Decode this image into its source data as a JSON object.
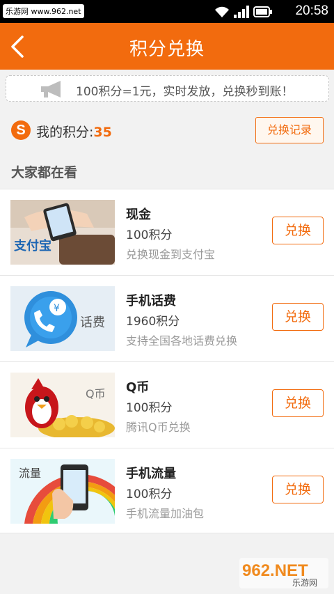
{
  "status_bar": {
    "watermark": "乐游网 www.962.net",
    "time": "20:58",
    "icons": [
      "wifi-icon",
      "signal-icon",
      "battery-icon"
    ]
  },
  "header": {
    "back_icon": "chevron-left-icon",
    "title": "积分兑换"
  },
  "notice": {
    "icon": "megaphone-icon",
    "text": "100积分=1元，实时发放，兑换秒到账！"
  },
  "points": {
    "label": "我的积分:",
    "value": "35",
    "record_button": "兑换记录"
  },
  "section_title": "大家都在看",
  "items": [
    {
      "name": "现金",
      "cost": "100积分",
      "desc": "兑换现金到支付宝",
      "button": "兑换",
      "thumb_text": "支付宝"
    },
    {
      "name": "手机话费",
      "cost": "1960积分",
      "desc": "支持全国各地话费兑换",
      "button": "兑换",
      "thumb_text": "话费"
    },
    {
      "name": "Q币",
      "cost": "100积分",
      "desc": "腾讯Q币兑换",
      "button": "兑换",
      "thumb_text": "Q币"
    },
    {
      "name": "手机流量",
      "cost": "100积分",
      "desc": "手机流量加油包",
      "button": "兑换",
      "thumb_text": "流量"
    }
  ],
  "footer_watermark": {
    "main": "962.NET",
    "sub": "乐游网"
  },
  "colors": {
    "accent": "#f26b0e",
    "status_bar": "#000000",
    "background": "#f2f2f2"
  }
}
